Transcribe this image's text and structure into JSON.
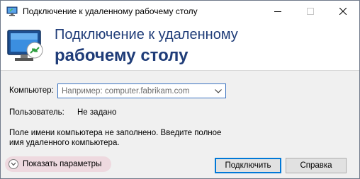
{
  "window": {
    "title": "Подключение к удаленному рабочему столу",
    "minimize_glyph": "—",
    "close_glyph": "✕"
  },
  "header": {
    "line1": "Подключение к удаленному",
    "line2": "рабочему столу",
    "icon": "remote-desktop-icon"
  },
  "form": {
    "computer_label": "Компьютер:",
    "computer_value": "",
    "computer_placeholder": "Например: computer.fabrikam.com",
    "user_label": "Пользователь:",
    "user_value": "Не задано"
  },
  "message": {
    "line1": "Поле имени компьютера не заполнено. Введите полное",
    "line2": "имя удаленного компьютера."
  },
  "footer": {
    "show_options_label": "Показать параметры",
    "connect_label": "Подключить",
    "help_label": "Справка"
  },
  "colors": {
    "header_text": "#1f3c78",
    "accent": "#0078d7",
    "options_highlight": "#eed9df"
  }
}
